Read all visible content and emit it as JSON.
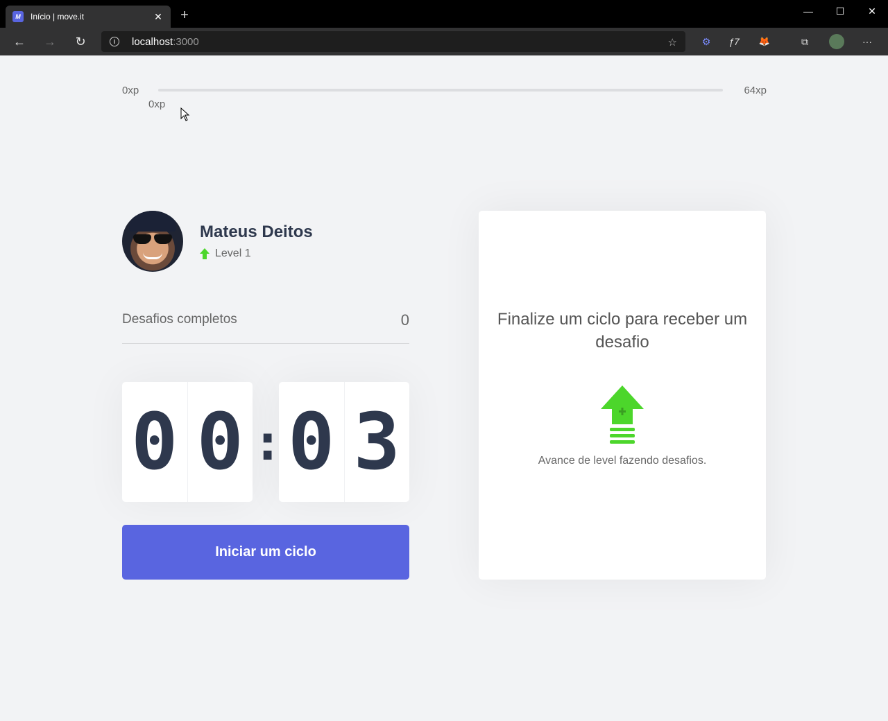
{
  "browser": {
    "tab_title": "Início | move.it",
    "tab_favicon": "M",
    "tab_close": "✕",
    "new_tab": "+",
    "window_controls": {
      "minimize": "—",
      "maximize": "☐",
      "close": "✕"
    },
    "nav": {
      "back": "←",
      "forward": "→",
      "reload": "↻"
    },
    "address": {
      "host": "localhost",
      "port": ":3000",
      "info_icon": "i",
      "favorite_icon": "☆"
    },
    "extensions": {
      "ext1": "⚙",
      "ext2": "ƒ7",
      "ext3": "🦊",
      "collections": "⧉",
      "more": "···"
    }
  },
  "xp_bar": {
    "min_label": "0xp",
    "max_label": "64xp",
    "current_label": "0xp",
    "progress_percent": 0
  },
  "profile": {
    "name": "Mateus Deitos",
    "level_label": "Level 1"
  },
  "completed_challenges": {
    "label": "Desafios completos",
    "count": "0"
  },
  "countdown": {
    "minute_left": "0",
    "minute_right": "0",
    "separator": ":",
    "second_left": "0",
    "second_right": "3"
  },
  "start_button": {
    "label": "Iniciar um ciclo"
  },
  "challenge_box": {
    "title": "Finalize um ciclo para receber um desafio",
    "text": "Avance de level fazendo desafios."
  },
  "colors": {
    "accent": "#5965e0",
    "level_green": "#4cd62b",
    "text_dark": "#2e384d",
    "background": "#f2f3f5"
  }
}
